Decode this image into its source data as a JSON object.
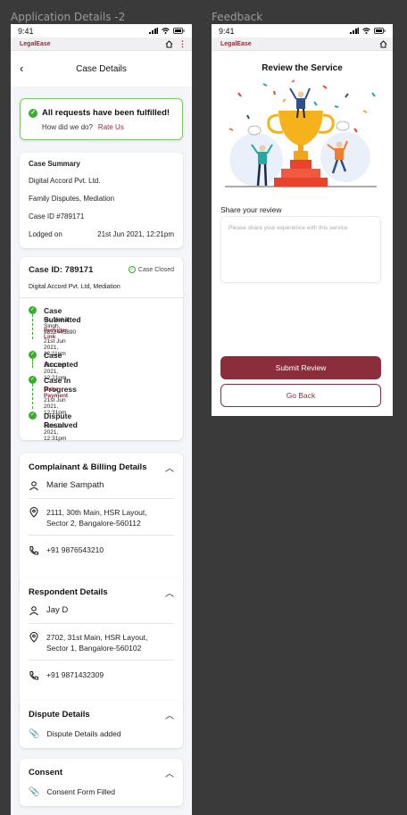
{
  "frames": {
    "left_label": "Application Details -2",
    "right_label": "Feedback"
  },
  "status": {
    "time": "9:41"
  },
  "app": {
    "brand": "LegalEase"
  },
  "details": {
    "title": "Case Details",
    "success": {
      "title": "All requests have been fulfilled!",
      "question": "How did we do?",
      "rate": "Rate Us"
    },
    "summary": {
      "heading": "Case Summary",
      "company": "Digital Accord Pvt. Ltd.",
      "type": "Family Disputes, Mediation",
      "case_id": "Case ID #789171",
      "lodged_label": "Lodged on",
      "lodged_value": "21st Jun 2021, 12:21pm"
    },
    "status_card": {
      "case_id_label": "Case ID:",
      "case_id_value": "789171",
      "badge": "Case Closed",
      "subtitle": "Digital Accord Pvt. Ltd, Mediation",
      "steps": [
        {
          "title": "Case Submitted",
          "detail": "Mr. Vishal Singh, 9832445890",
          "link": "Provider Link",
          "time": "21st Jun 2021, 12:11pm"
        },
        {
          "title": "Case Accepted",
          "time": "21st Jun 2021, 12:21pm"
        },
        {
          "title": "Case in Progress",
          "link": "Make Payment",
          "time": "21st Jun 2021, 12:31pm"
        },
        {
          "title": "Dispute Resolved",
          "time": "21st Jun 2021, 12:31pm"
        }
      ]
    },
    "complainant": {
      "heading": "Complainant & Billing Details",
      "name": "Marie Sampath",
      "address_1": "2111, 30th Main, HSR Layout,",
      "address_2": "Sector 2, Bangalore-560112",
      "phone": "+91 9876543210"
    },
    "respondent": {
      "heading": "Respondent Details",
      "name": "Jay D",
      "address_1": "2702, 31st Main, HSR Layout,",
      "address_2": "Sector 1, Bangalore-560102",
      "phone": "+91 9871432309"
    },
    "dispute": {
      "heading": "Dispute Details",
      "item": "Dispute Details added"
    },
    "consent": {
      "heading": "Consent",
      "item": "Consent Form Filled"
    }
  },
  "feedback": {
    "title": "Review the Service",
    "share_label": "Share your review",
    "placeholder": "Please share your experience with this service",
    "submit": "Submit Review",
    "back": "Go Back"
  },
  "colors": {
    "brand": "#8b2d3a",
    "success": "#3cac2f"
  }
}
